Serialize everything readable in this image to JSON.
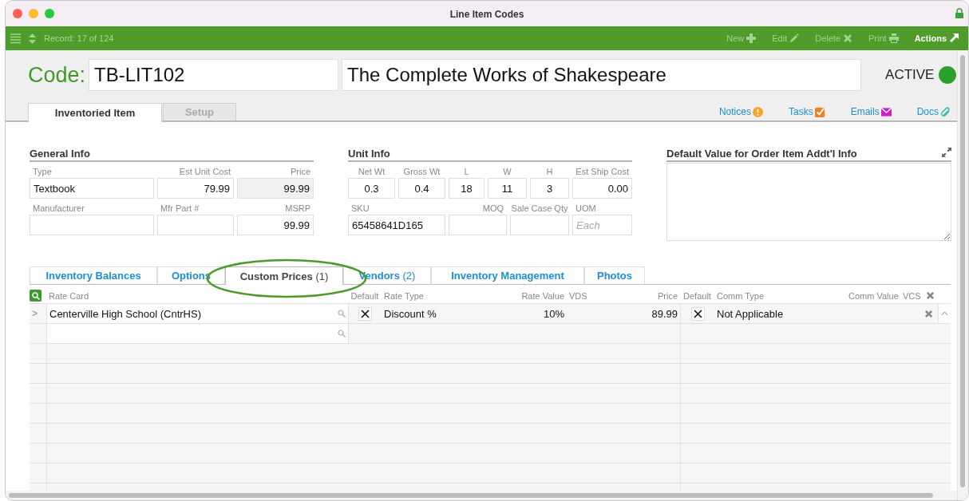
{
  "window": {
    "title": "Line Item Codes"
  },
  "toolbar": {
    "record": "Record: 17 of 124",
    "actions": [
      {
        "label": "New",
        "kind": "add",
        "disabled": true
      },
      {
        "label": "Edit",
        "kind": "edit",
        "disabled": true
      },
      {
        "label": "Delete",
        "kind": "delete",
        "disabled": true
      },
      {
        "label": "Print",
        "kind": "print",
        "disabled": true
      },
      {
        "label": "Actions",
        "kind": "actions",
        "disabled": false
      }
    ]
  },
  "header": {
    "code_label": "Code:",
    "code": "TB-LIT102",
    "description": "The Complete Works of Shakespeare",
    "status": "ACTIVE",
    "active": true
  },
  "tabs": [
    {
      "label": "Inventoried Item",
      "selected": true
    },
    {
      "label": "Setup",
      "selected": false
    }
  ],
  "links": [
    {
      "label": "Notices",
      "kind": "notices"
    },
    {
      "label": "Tasks",
      "kind": "tasks"
    },
    {
      "label": "Emails",
      "kind": "emails"
    },
    {
      "label": "Docs",
      "kind": "docs"
    }
  ],
  "sections": [
    {
      "kind": "general",
      "title": "General Info",
      "rows": [
        {
          "fields": [
            {
              "label": "Type",
              "value": "Textbook",
              "readonly": false
            },
            {
              "label": "Est Unit Cost",
              "value": "79.99",
              "readonly": false
            },
            {
              "label": "Price",
              "value": "99.99",
              "readonly": true
            }
          ]
        },
        {
          "fields": [
            {
              "label": "Manufacturer",
              "readonly": false
            },
            {
              "label": "Mfr Part #",
              "readonly": false
            },
            {
              "label": "MSRP",
              "value": "99.99",
              "readonly": false
            }
          ]
        }
      ]
    },
    {
      "kind": "unit",
      "title": "Unit Info",
      "rows": [
        {
          "fields": [
            {
              "label": "Net Wt",
              "value": "0.3",
              "readonly": false
            },
            {
              "label": "Gross Wt",
              "value": "0.4",
              "readonly": false
            },
            {
              "label": "L",
              "value": "18",
              "readonly": false
            },
            {
              "label": "W",
              "value": "11",
              "readonly": false
            },
            {
              "label": "H",
              "value": "3",
              "readonly": false
            },
            {
              "label": "Est Ship Cost",
              "value": "0.00",
              "readonly": false
            }
          ]
        },
        {
          "fields": [
            {
              "label": "SKU",
              "value": "65458641D165",
              "readonly": false
            },
            {
              "label": "MOQ",
              "readonly": false
            },
            {
              "label": "Sale Case Qty",
              "readonly": false
            },
            {
              "label": "UOM",
              "placeholder": "Each",
              "readonly": false
            }
          ]
        }
      ]
    }
  ],
  "notes": {
    "title": "Default Value for Order Item Addt'l Info"
  },
  "sub_tabs": [
    {
      "label": "Inventory Balances",
      "selected": false
    },
    {
      "label": "Options",
      "selected": false
    },
    {
      "label": "Custom Prices",
      "count": "(1)",
      "selected": true
    },
    {
      "label": "Vendors",
      "count": "(2)",
      "selected": false
    },
    {
      "label": "Inventory Management",
      "selected": false
    },
    {
      "label": "Photos",
      "selected": false
    }
  ],
  "grid": {
    "columns": [
      "Rate Card",
      "Default",
      "Rate Type",
      "Rate Value",
      "VDS",
      "Price",
      "Default",
      "Comm Type",
      "Comm Value",
      "VCS"
    ],
    "rows": [
      {
        "marker": ">",
        "rate_card": "Centerville High School  (CntrHS)",
        "default": true,
        "rate_type": "Discount %",
        "rate_value": "10%",
        "price": "89.99",
        "comm_default": true,
        "comm_type": "Not Applicable"
      }
    ]
  }
}
